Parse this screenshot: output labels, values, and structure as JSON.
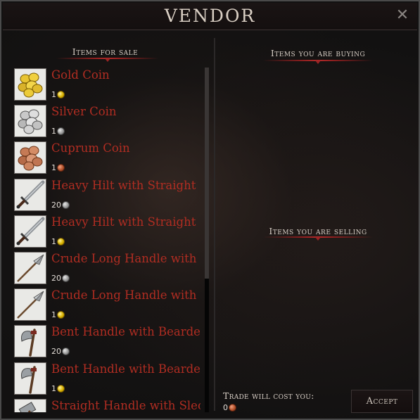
{
  "window": {
    "title": "Vendor"
  },
  "sections": {
    "for_sale": "Items for sale",
    "buying": "Items you are buying",
    "selling": "Items you are selling"
  },
  "items": [
    {
      "name": "Gold Coin",
      "price": "1",
      "currency": "gold",
      "icon": "gold-coins-icon"
    },
    {
      "name": "Silver Coin",
      "price": "1",
      "currency": "silver",
      "icon": "silver-coins-icon"
    },
    {
      "name": "Cuprum Coin",
      "price": "1",
      "currency": "copper",
      "icon": "cuprum-coins-icon"
    },
    {
      "name": "Heavy Hilt with Straight",
      "price": "20",
      "currency": "silver",
      "icon": "sword-icon"
    },
    {
      "name": "Heavy Hilt with Straight",
      "price": "1",
      "currency": "gold",
      "icon": "sword-icon"
    },
    {
      "name": "Crude Long Handle with",
      "price": "20",
      "currency": "silver",
      "icon": "spear-icon"
    },
    {
      "name": "Crude Long Handle with",
      "price": "1",
      "currency": "gold",
      "icon": "spear-icon"
    },
    {
      "name": "Bent Handle with Bearde",
      "price": "20",
      "currency": "silver",
      "icon": "axe-icon"
    },
    {
      "name": "Bent Handle with Bearde",
      "price": "1",
      "currency": "gold",
      "icon": "axe-icon"
    },
    {
      "name": "Straight Handle with Slec",
      "price": "",
      "currency": "",
      "icon": "sledge-icon"
    }
  ],
  "footer": {
    "cost_label": "Trade will cost you:",
    "cost_value": "0",
    "cost_currency": "copper",
    "accept_label": "Accept"
  },
  "colors": {
    "item_name": "#b12d22",
    "accent_red": "#b52a2a",
    "heading": "#d8cfc6"
  }
}
